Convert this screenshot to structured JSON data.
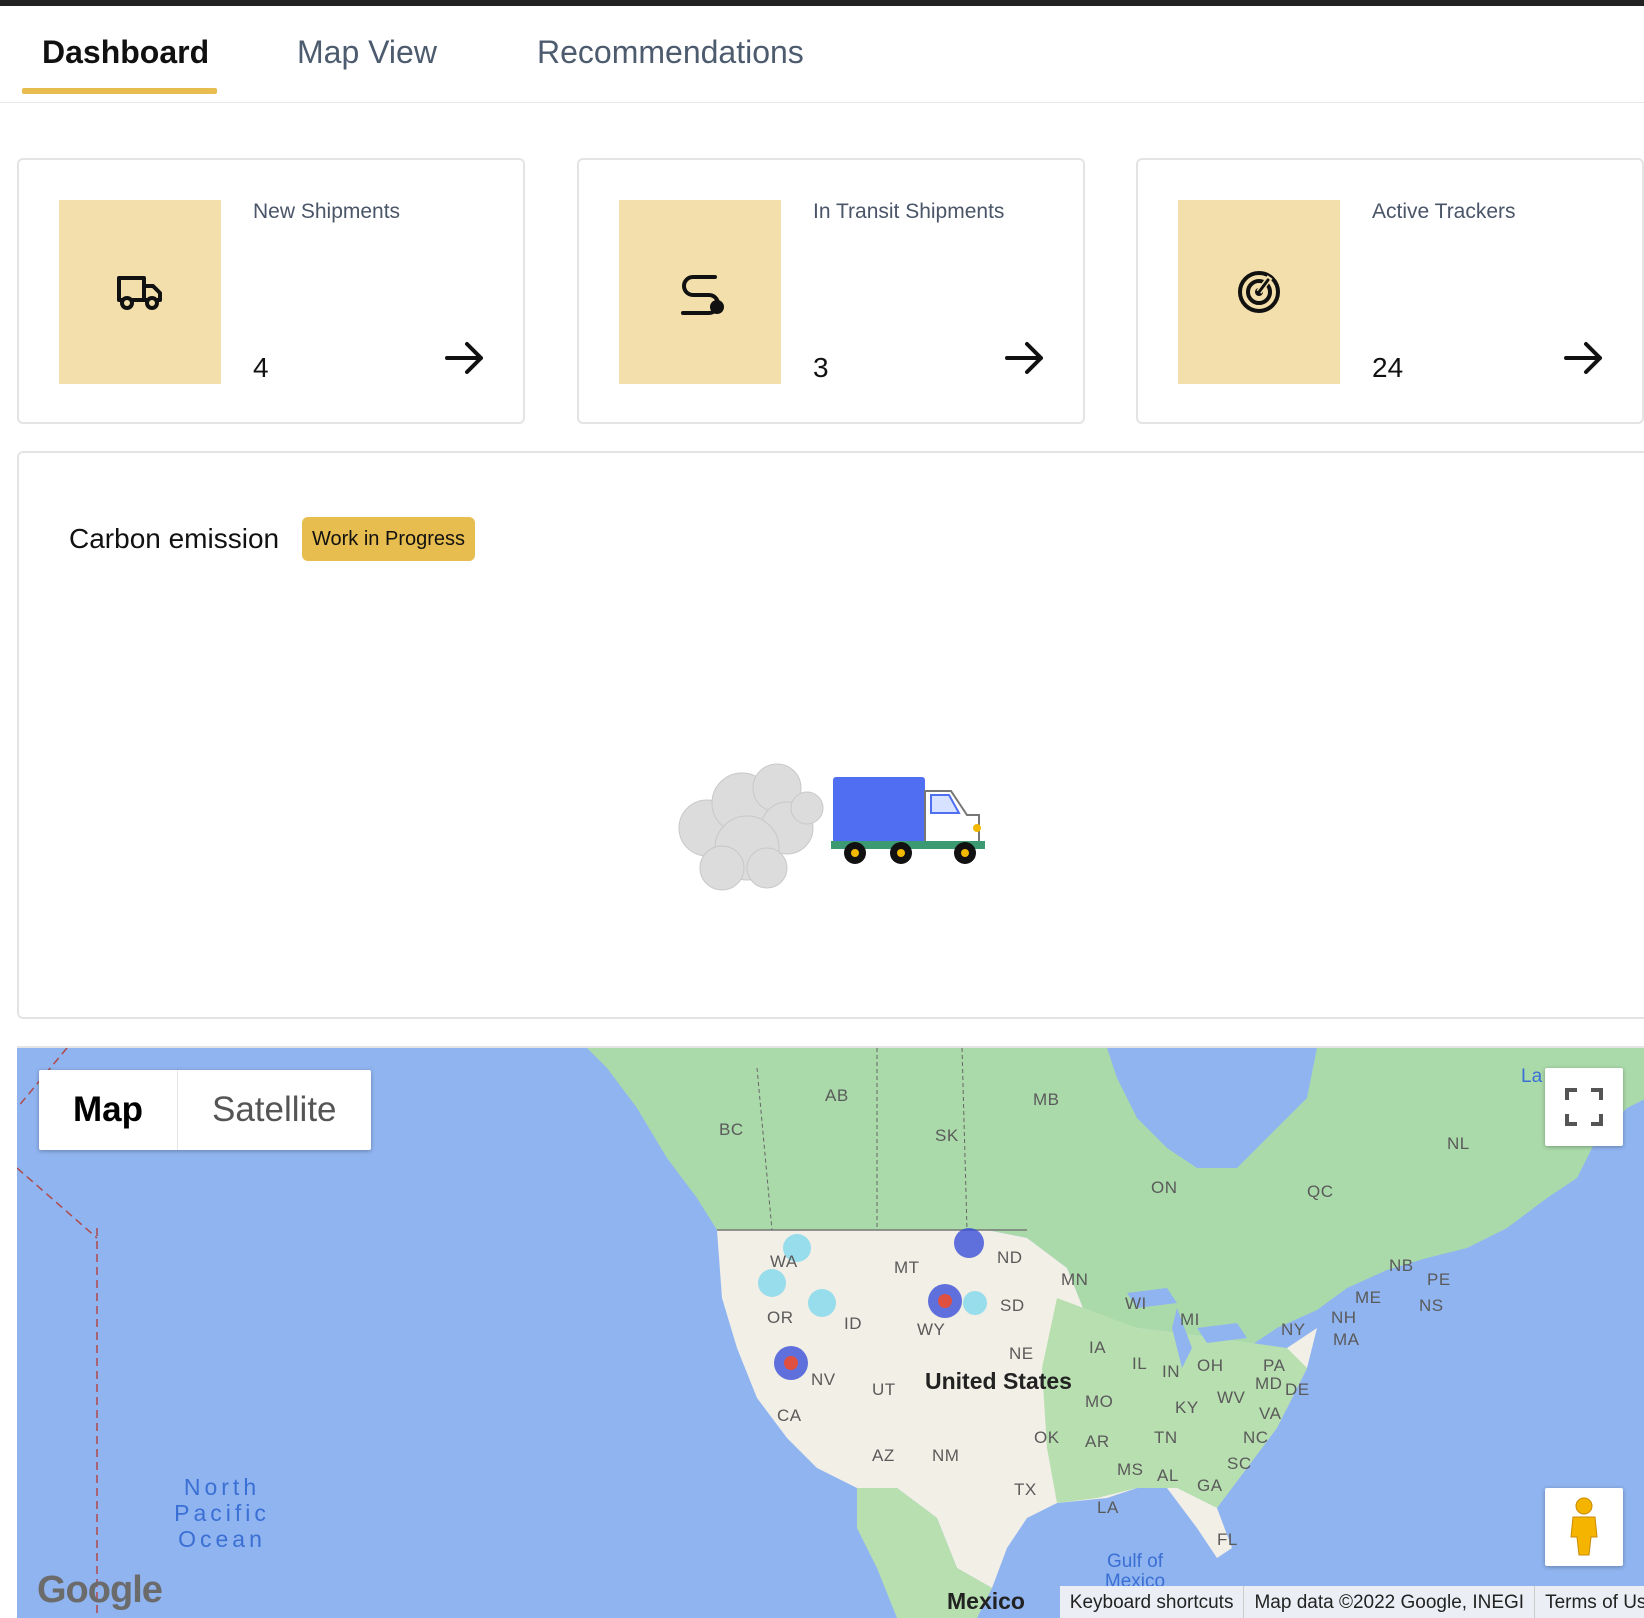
{
  "tabs": [
    "Dashboard",
    "Map View",
    "Recommendations"
  ],
  "cards": [
    {
      "title": "New Shipments",
      "count": "4",
      "icon": "truck-icon"
    },
    {
      "title": "In Transit Shipments",
      "count": "3",
      "icon": "route-icon"
    },
    {
      "title": "Active Trackers",
      "count": "24",
      "icon": "radar-icon"
    }
  ],
  "emission": {
    "title": "Carbon emission",
    "badge": "Work in Progress"
  },
  "map": {
    "type_options": [
      "Map",
      "Satellite"
    ],
    "selected_type": "Map",
    "country_label": "United States",
    "ocean_label": "North Pacific Ocean",
    "gulf_label": "Gulf of Mexico",
    "mexico_label": "Mexico",
    "partial_label": "La",
    "region_labels": [
      "AB",
      "BC",
      "SK",
      "MB",
      "ON",
      "QC",
      "NL",
      "NB",
      "PE",
      "NS",
      "WA",
      "OR",
      "ID",
      "MT",
      "WY",
      "ND",
      "SD",
      "MN",
      "NE",
      "IA",
      "WI",
      "MI",
      "IL",
      "IN",
      "OH",
      "NY",
      "PA",
      "MD",
      "DE",
      "NH",
      "MA",
      "ME",
      "NV",
      "CA",
      "UT",
      "AZ",
      "NM",
      "TX",
      "OK",
      "MO",
      "KY",
      "WV",
      "VA",
      "NC",
      "TN",
      "AR",
      "MS",
      "AL",
      "GA",
      "SC",
      "LA",
      "FL"
    ],
    "footer": [
      "Keyboard shortcuts",
      "Map data ©2022 Google, INEGI",
      "Terms of Use"
    ],
    "logo": "Google"
  },
  "colors": {
    "accent": "#e7bd4f",
    "icon_bg": "#f3dfab",
    "water": "#90b4f0",
    "land": "#aadaaa",
    "us_land": "#f2efe6"
  }
}
